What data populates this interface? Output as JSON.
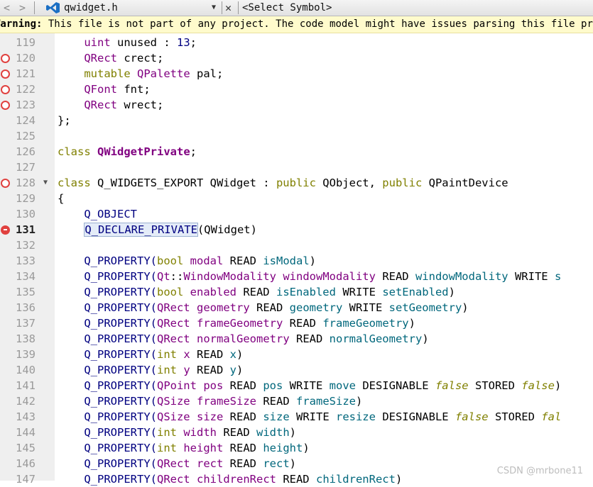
{
  "toolbar": {
    "back": "<",
    "forward": ">",
    "filename": "qwidget.h",
    "dropdown": "▼",
    "close": "✕",
    "symbol": "<Select Symbol>"
  },
  "warning": {
    "label": "Warning:",
    "message": "This file is not part of any project. The code model might have issues parsing this file properly."
  },
  "lines": {
    "l119": {
      "n": "119",
      "t": [
        [
          "    ",
          ""
        ],
        [
          "uint",
          "ty"
        ],
        [
          " ",
          ""
        ],
        [
          "unused",
          "mem"
        ],
        [
          " : ",
          ""
        ],
        [
          "13",
          "num"
        ],
        [
          ";",
          ""
        ]
      ]
    },
    "l120": {
      "n": "120",
      "t": [
        [
          "    ",
          ""
        ],
        [
          "QRect",
          "ty"
        ],
        [
          " crect;",
          ""
        ]
      ]
    },
    "l121": {
      "n": "121",
      "t": [
        [
          "    ",
          ""
        ],
        [
          "mutable",
          "kw"
        ],
        [
          " ",
          ""
        ],
        [
          "QPalette",
          "ty"
        ],
        [
          " pal;",
          ""
        ]
      ]
    },
    "l122": {
      "n": "122",
      "t": [
        [
          "    ",
          ""
        ],
        [
          "QFont",
          "ty"
        ],
        [
          " fnt;",
          ""
        ]
      ]
    },
    "l123": {
      "n": "123",
      "t": [
        [
          "    ",
          ""
        ],
        [
          "QRect",
          "ty"
        ],
        [
          " wrect;",
          ""
        ]
      ]
    },
    "l124": {
      "n": "124",
      "t": [
        [
          "};",
          ""
        ]
      ]
    },
    "l125": {
      "n": "125",
      "t": []
    },
    "l126": {
      "n": "126",
      "t": [
        [
          "class",
          "kw"
        ],
        [
          " ",
          ""
        ],
        [
          "QWidgetPrivate",
          "cls"
        ],
        [
          ";",
          ""
        ]
      ]
    },
    "l127": {
      "n": "127",
      "t": []
    },
    "l128": {
      "n": "128",
      "t": [
        [
          "class",
          "kw"
        ],
        [
          " Q_WIDGETS_EXPORT QWidget : ",
          ""
        ],
        [
          "public",
          "kw"
        ],
        [
          " QObject, ",
          ""
        ],
        [
          "public",
          "kw"
        ],
        [
          " QPaintDevice",
          ""
        ]
      ]
    },
    "l129": {
      "n": "129",
      "t": [
        [
          "{",
          ""
        ]
      ]
    },
    "l130": {
      "n": "130",
      "t": [
        [
          "    Q_OBJECT",
          "def"
        ]
      ]
    },
    "l131": {
      "n": "131",
      "t": [
        [
          "    ",
          ""
        ],
        [
          "Q_DECLARE_PRIVATE",
          "defhl"
        ],
        [
          "(QWidget)",
          ""
        ]
      ]
    },
    "l132": {
      "n": "132",
      "t": []
    },
    "l133": {
      "n": "133",
      "t": [
        [
          "    Q_PROPERTY(",
          "def"
        ],
        [
          "bool",
          "kw"
        ],
        [
          " ",
          ""
        ],
        [
          "modal",
          "ty"
        ],
        [
          " READ ",
          ""
        ],
        [
          "isModal",
          "fn"
        ],
        [
          ")",
          ""
        ]
      ]
    },
    "l134": {
      "n": "134",
      "t": [
        [
          "    Q_PROPERTY(",
          "def"
        ],
        [
          "Qt",
          "ty"
        ],
        [
          "::",
          ""
        ],
        [
          "WindowModality",
          "ty"
        ],
        [
          " ",
          ""
        ],
        [
          "windowModality",
          "ty"
        ],
        [
          " READ ",
          ""
        ],
        [
          "windowModality",
          "fn"
        ],
        [
          " WRITE ",
          ""
        ],
        [
          "s",
          "fn"
        ]
      ]
    },
    "l135": {
      "n": "135",
      "t": [
        [
          "    Q_PROPERTY(",
          "def"
        ],
        [
          "bool",
          "kw"
        ],
        [
          " ",
          ""
        ],
        [
          "enabled",
          "ty"
        ],
        [
          " READ ",
          ""
        ],
        [
          "isEnabled",
          "fn"
        ],
        [
          " WRITE ",
          ""
        ],
        [
          "setEnabled",
          "fn"
        ],
        [
          ")",
          ""
        ]
      ]
    },
    "l136": {
      "n": "136",
      "t": [
        [
          "    Q_PROPERTY(",
          "def"
        ],
        [
          "QRect",
          "ty"
        ],
        [
          " ",
          ""
        ],
        [
          "geometry",
          "ty"
        ],
        [
          " READ ",
          ""
        ],
        [
          "geometry",
          "fn"
        ],
        [
          " WRITE ",
          ""
        ],
        [
          "setGeometry",
          "fn"
        ],
        [
          ")",
          ""
        ]
      ]
    },
    "l137": {
      "n": "137",
      "t": [
        [
          "    Q_PROPERTY(",
          "def"
        ],
        [
          "QRect",
          "ty"
        ],
        [
          " ",
          ""
        ],
        [
          "frameGeometry",
          "ty"
        ],
        [
          " READ ",
          ""
        ],
        [
          "frameGeometry",
          "fn"
        ],
        [
          ")",
          ""
        ]
      ]
    },
    "l138": {
      "n": "138",
      "t": [
        [
          "    Q_PROPERTY(",
          "def"
        ],
        [
          "QRect",
          "ty"
        ],
        [
          " ",
          ""
        ],
        [
          "normalGeometry",
          "ty"
        ],
        [
          " READ ",
          ""
        ],
        [
          "normalGeometry",
          "fn"
        ],
        [
          ")",
          ""
        ]
      ]
    },
    "l139": {
      "n": "139",
      "t": [
        [
          "    Q_PROPERTY(",
          "def"
        ],
        [
          "int",
          "kw"
        ],
        [
          " ",
          ""
        ],
        [
          "x",
          "ty"
        ],
        [
          " READ ",
          ""
        ],
        [
          "x",
          "fn"
        ],
        [
          ")",
          ""
        ]
      ]
    },
    "l140": {
      "n": "140",
      "t": [
        [
          "    Q_PROPERTY(",
          "def"
        ],
        [
          "int",
          "kw"
        ],
        [
          " ",
          ""
        ],
        [
          "y",
          "ty"
        ],
        [
          " READ ",
          ""
        ],
        [
          "y",
          "fn"
        ],
        [
          ")",
          ""
        ]
      ]
    },
    "l141": {
      "n": "141",
      "t": [
        [
          "    Q_PROPERTY(",
          "def"
        ],
        [
          "QPoint",
          "ty"
        ],
        [
          " ",
          ""
        ],
        [
          "pos",
          "ty"
        ],
        [
          " READ ",
          ""
        ],
        [
          "pos",
          "fn"
        ],
        [
          " WRITE ",
          ""
        ],
        [
          "move",
          "fn"
        ],
        [
          " DESIGNABLE ",
          ""
        ],
        [
          "false",
          "bool"
        ],
        [
          " STORED ",
          ""
        ],
        [
          "false",
          "bool"
        ],
        [
          ")",
          ""
        ]
      ]
    },
    "l142": {
      "n": "142",
      "t": [
        [
          "    Q_PROPERTY(",
          "def"
        ],
        [
          "QSize",
          "ty"
        ],
        [
          " ",
          ""
        ],
        [
          "frameSize",
          "ty"
        ],
        [
          " READ ",
          ""
        ],
        [
          "frameSize",
          "fn"
        ],
        [
          ")",
          ""
        ]
      ]
    },
    "l143": {
      "n": "143",
      "t": [
        [
          "    Q_PROPERTY(",
          "def"
        ],
        [
          "QSize",
          "ty"
        ],
        [
          " ",
          ""
        ],
        [
          "size",
          "ty"
        ],
        [
          " READ ",
          ""
        ],
        [
          "size",
          "fn"
        ],
        [
          " WRITE ",
          ""
        ],
        [
          "resize",
          "fn"
        ],
        [
          " DESIGNABLE ",
          ""
        ],
        [
          "false",
          "bool"
        ],
        [
          " STORED ",
          ""
        ],
        [
          "fal",
          "bool"
        ]
      ]
    },
    "l144": {
      "n": "144",
      "t": [
        [
          "    Q_PROPERTY(",
          "def"
        ],
        [
          "int",
          "kw"
        ],
        [
          " ",
          ""
        ],
        [
          "width",
          "ty"
        ],
        [
          " READ ",
          ""
        ],
        [
          "width",
          "fn"
        ],
        [
          ")",
          ""
        ]
      ]
    },
    "l145": {
      "n": "145",
      "t": [
        [
          "    Q_PROPERTY(",
          "def"
        ],
        [
          "int",
          "kw"
        ],
        [
          " ",
          ""
        ],
        [
          "height",
          "ty"
        ],
        [
          " READ ",
          ""
        ],
        [
          "height",
          "fn"
        ],
        [
          ")",
          ""
        ]
      ]
    },
    "l146": {
      "n": "146",
      "t": [
        [
          "    Q_PROPERTY(",
          "def"
        ],
        [
          "QRect",
          "ty"
        ],
        [
          " ",
          ""
        ],
        [
          "rect",
          "ty"
        ],
        [
          " READ ",
          ""
        ],
        [
          "rect",
          "fn"
        ],
        [
          ")",
          ""
        ]
      ]
    },
    "l147": {
      "n": "147",
      "t": [
        [
          "    Q_PROPERTY(",
          "def"
        ],
        [
          "QRect",
          "ty"
        ],
        [
          " ",
          ""
        ],
        [
          "childrenRect",
          "ty"
        ],
        [
          " READ ",
          ""
        ],
        [
          "childrenRect",
          "fn"
        ],
        [
          ")",
          ""
        ]
      ]
    }
  },
  "breakpoints": [
    "120",
    "121",
    "122",
    "123",
    "128"
  ],
  "active_breakpoint": "131",
  "current_line": "131",
  "fold_line": "128",
  "watermark": "CSDN @mrbone11",
  "colors": {
    "keyword": "#808000",
    "type": "#800080",
    "function": "#00677c",
    "macro": "#000080",
    "breakpoint": "#e0413f",
    "warning_bg": "#fffbcc"
  }
}
